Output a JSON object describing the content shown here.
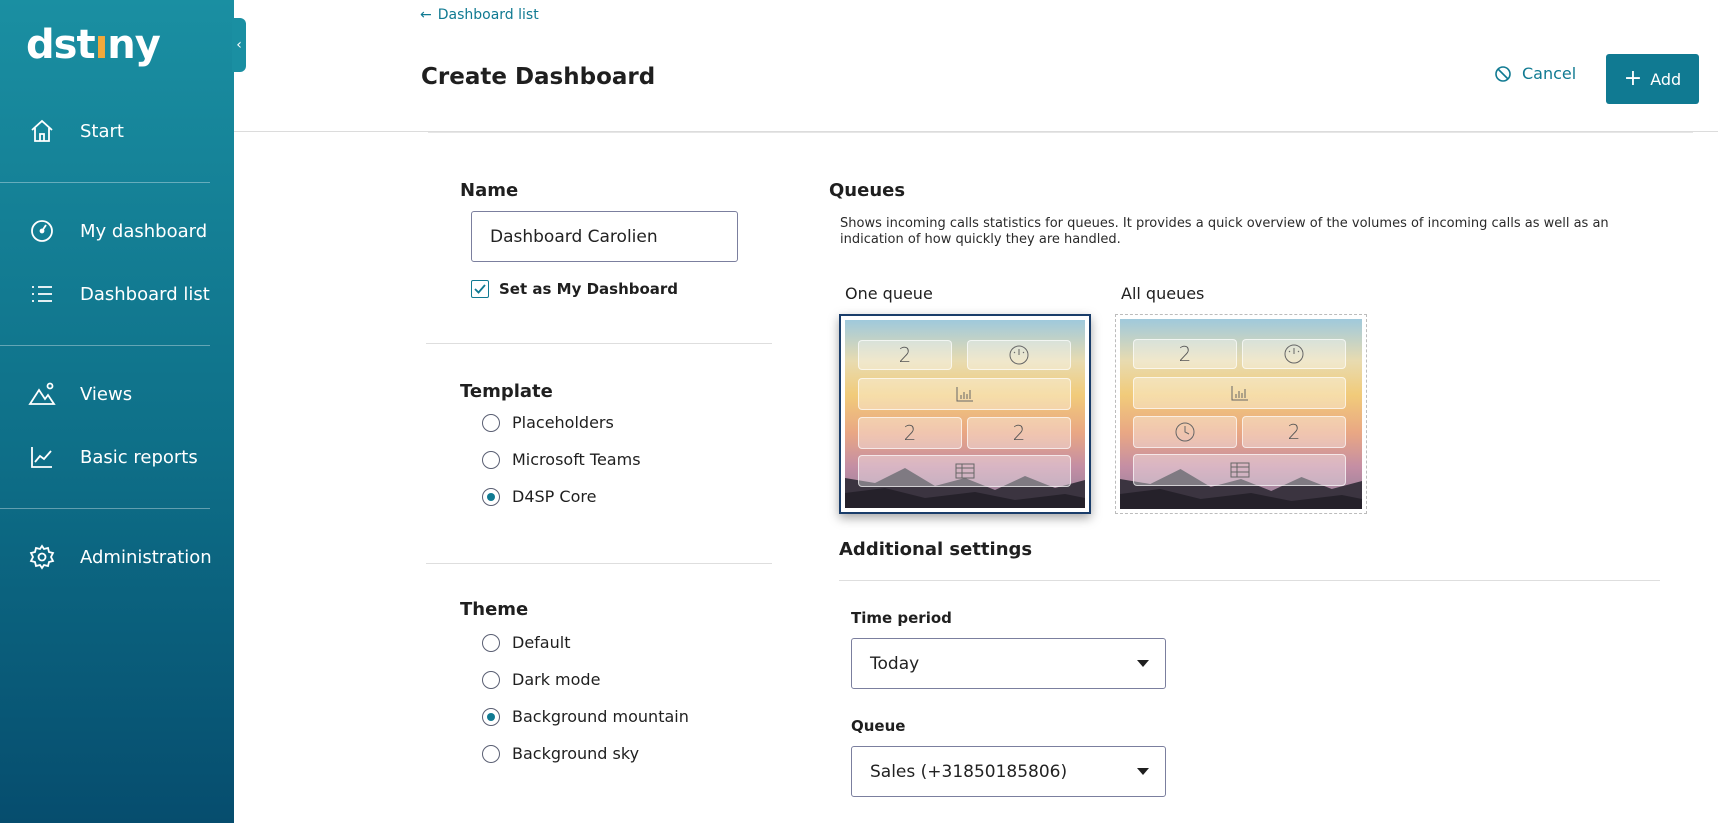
{
  "brand": {
    "logo_pre": "dst",
    "logo_dot": "ı",
    "logo_post": "ny",
    "accent": "#107a92",
    "dot_color": "#f2a93b"
  },
  "sidebar": {
    "items": [
      {
        "label": "Start",
        "icon": "home-icon"
      },
      {
        "label": "My dashboard",
        "icon": "gauge-icon"
      },
      {
        "label": "Dashboard list",
        "icon": "list-icon"
      },
      {
        "label": "Views",
        "icon": "mountain-icon"
      },
      {
        "label": "Basic reports",
        "icon": "line-chart-icon"
      },
      {
        "label": "Administration",
        "icon": "gear-icon"
      }
    ]
  },
  "header": {
    "back_link": "Dashboard list",
    "title": "Create Dashboard",
    "cancel_label": "Cancel",
    "add_label": "Add"
  },
  "form": {
    "name_label": "Name",
    "name_value": "Dashboard Carolien",
    "set_my_dashboard": "Set as My Dashboard",
    "template_label": "Template",
    "template_options": [
      "Placeholders",
      "Microsoft Teams",
      "D4SP Core"
    ],
    "template_selected": "D4SP Core",
    "theme_label": "Theme",
    "theme_options": [
      "Default",
      "Dark mode",
      "Background mountain",
      "Background sky"
    ],
    "theme_selected": "Background mountain"
  },
  "queues": {
    "title": "Queues",
    "description": "Shows incoming calls statistics for queues. It provides a quick overview of the volumes of incoming calls as well as an indication of how quickly they are handled.",
    "cards": [
      {
        "label": "One queue",
        "selected": true,
        "tiles": [
          "2",
          "gauge",
          "bars",
          "2",
          "2",
          "table"
        ]
      },
      {
        "label": "All queues",
        "selected": false,
        "tiles": [
          "2",
          "gauge",
          "bars",
          "clock",
          "2",
          "table"
        ]
      }
    ]
  },
  "additional": {
    "title": "Additional settings",
    "time_period_label": "Time period",
    "time_period_value": "Today",
    "queue_label": "Queue",
    "queue_value": "Sales (+31850185806)"
  }
}
